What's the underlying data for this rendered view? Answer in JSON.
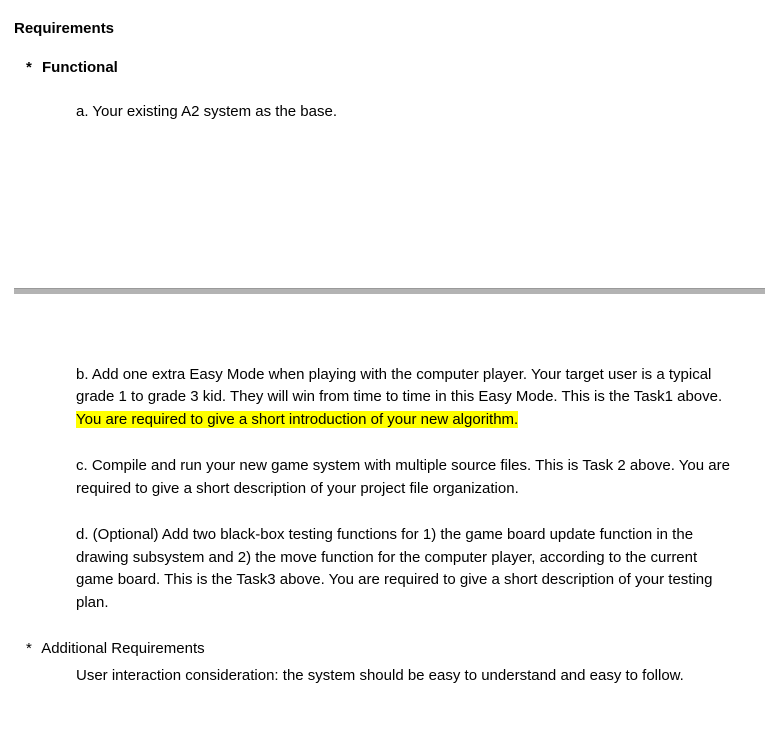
{
  "heading": "Requirements",
  "functional": {
    "label": "Functional",
    "items": {
      "a": "a. Your existing A2 system as the base.",
      "b_pre": "b. Add one extra Easy Mode when playing with the computer player. Your target user is a typical grade 1 to grade 3 kid. They will win from time to time in this Easy Mode. This is the Task1 above. ",
      "b_highlight": "You are required to give a short introduction of your new algorithm.",
      "c": "c. Compile and run your new game system with multiple source files. This is Task 2 above. You are required to give a short description of your project file organization.",
      "d": "d. (Optional) Add two black-box testing functions for 1) the game board update function in the drawing subsystem and 2) the move function for the computer player, according to the current game board. This is the Task3 above. You are required to give a short description of your testing plan."
    }
  },
  "additional": {
    "label": "Additional Requirements",
    "text": "User interaction consideration: the system should be easy to understand and easy to follow."
  },
  "asterisk": "*"
}
